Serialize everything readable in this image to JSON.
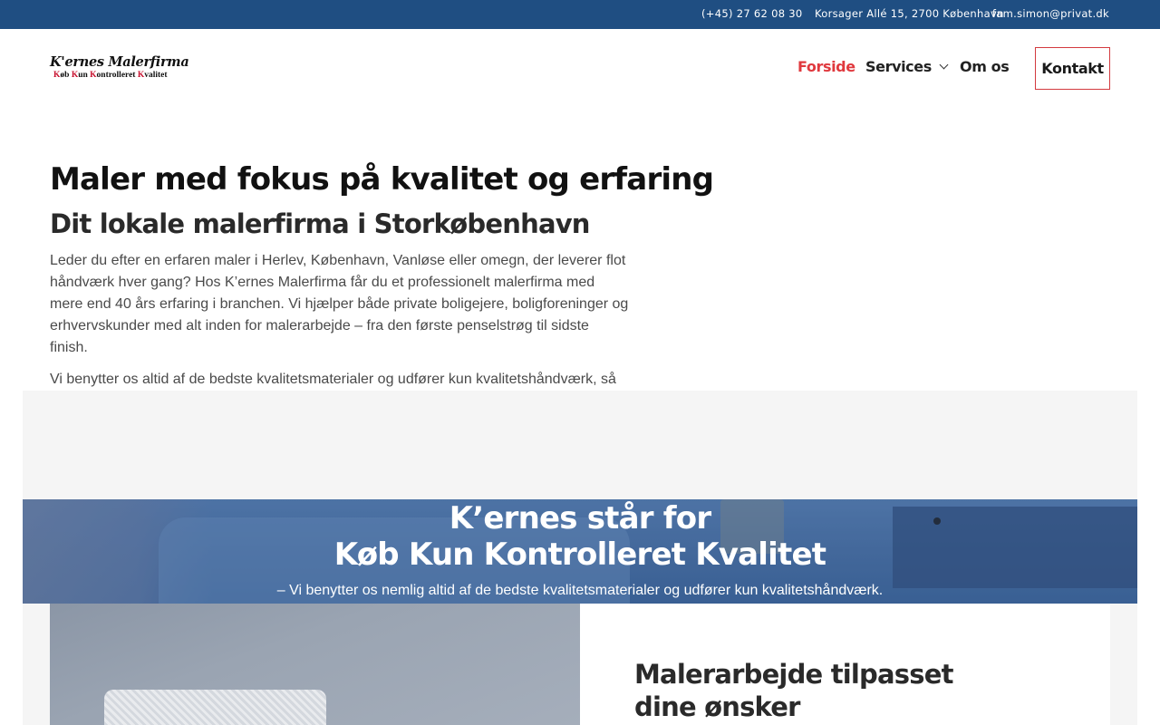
{
  "topbar": {
    "phone": "(+45) 27 62 08 30",
    "address": "Korsager Allé 15, 2700 København",
    "email": "fam.simon@privat.dk"
  },
  "logo": {
    "name": "K'ernes Malerfirma",
    "tagline_parts": [
      {
        "cap": "K",
        "rest": "øb "
      },
      {
        "cap": "K",
        "rest": "un "
      },
      {
        "cap": "K",
        "rest": "ontrolleret "
      },
      {
        "cap": "K",
        "rest": "valitet"
      }
    ]
  },
  "nav": {
    "items": [
      {
        "label": "Forside",
        "active": true
      },
      {
        "label": "Services",
        "has_dropdown": true
      },
      {
        "label": "Om os"
      }
    ],
    "cta": "Kontakt"
  },
  "main": {
    "title": "Maler med fokus på kvalitet og erfaring",
    "subtitle": "Dit lokale malerfirma i Storkøbenhavn",
    "paragraphs": [
      "Leder du efter en erfaren maler i Herlev, København, Vanløse eller omegn, der leverer flot håndværk hver gang? Hos K’ernes Malerfirma får du et professionelt malerfirma med mere end 40 års erfaring i branchen. Vi hjælper både private boligejere, boligforeninger og erhvervskunder med alt inden for malerarbejde – fra den første penselstrøg til sidste finish.",
      "Vi benytter os altid af de bedste kvalitetsmaterialer og udfører kun kvalitetshåndværk, så resultatet både holder og ser godt ud i mange år frem."
    ]
  },
  "hero": {
    "line1": "K’ernes står for",
    "line2": "Køb Kun Kontrolleret Kvalitet",
    "sub": "– Vi benytter os nemlig altid af de bedste kvalitetsmaterialer og udfører kun kvalitetshåndværk."
  },
  "section": {
    "heading": "Malerarbejde tilpasset dine ønsker"
  },
  "colors": {
    "topbar": "#1f4e82",
    "accent": "#e0393e",
    "cta_border": "#d33a3f"
  }
}
